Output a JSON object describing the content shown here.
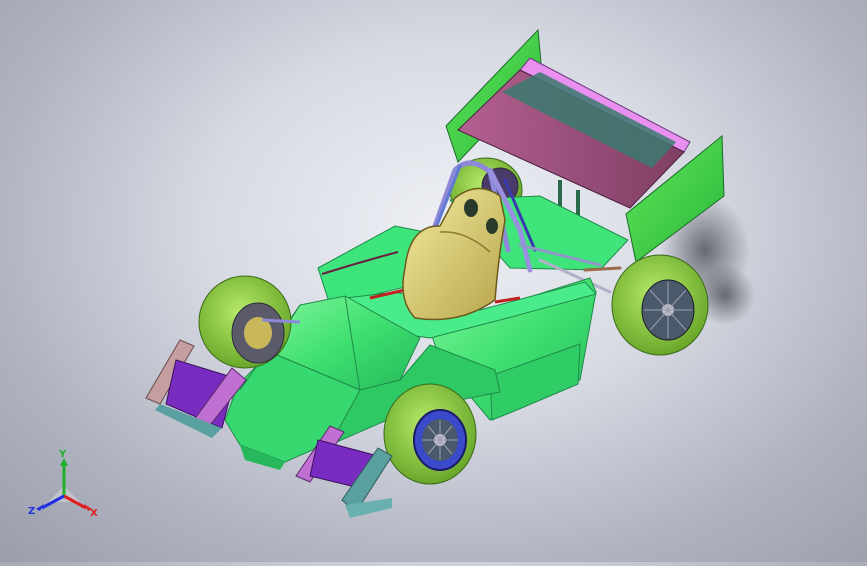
{
  "viewport": {
    "background_center": "#eef0f5",
    "background_edge": "#9a9eaa"
  },
  "model": {
    "body_color": "#3ee070",
    "wing_color": "#3ecf45",
    "wing_plane_color": "#a0547a",
    "wing_endplate_color": "#e98ff0",
    "seat_color": "#d8c86a",
    "tire_color": "#8fd13a",
    "rim_color": "#5a6a7a",
    "frame_color": "#8d88d8",
    "nose_plate_color": "#7a2cc0",
    "nose_bracket_color": "#c49ea0"
  },
  "triad": {
    "x_label": "X",
    "y_label": "Y",
    "z_label": "Z",
    "x_color": "#e02020",
    "y_color": "#20b030",
    "z_color": "#2030e0"
  }
}
